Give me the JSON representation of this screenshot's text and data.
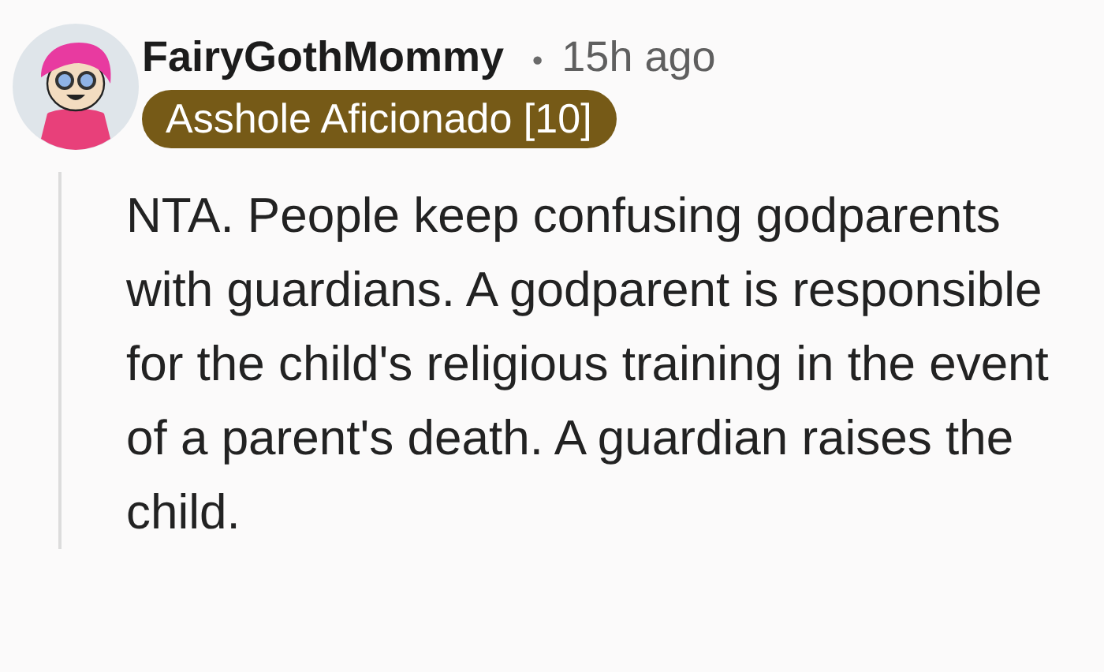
{
  "comment": {
    "author": "FairyGothMommy",
    "separator": "•",
    "time": "15h ago",
    "flair": {
      "text": "Asshole Aficionado [10]",
      "color": "#765a17"
    },
    "body": "NTA. People keep confusing godparents with guardians. A godparent is responsible for the child's religious training in the event of a parent's death. A guardian raises the child."
  }
}
